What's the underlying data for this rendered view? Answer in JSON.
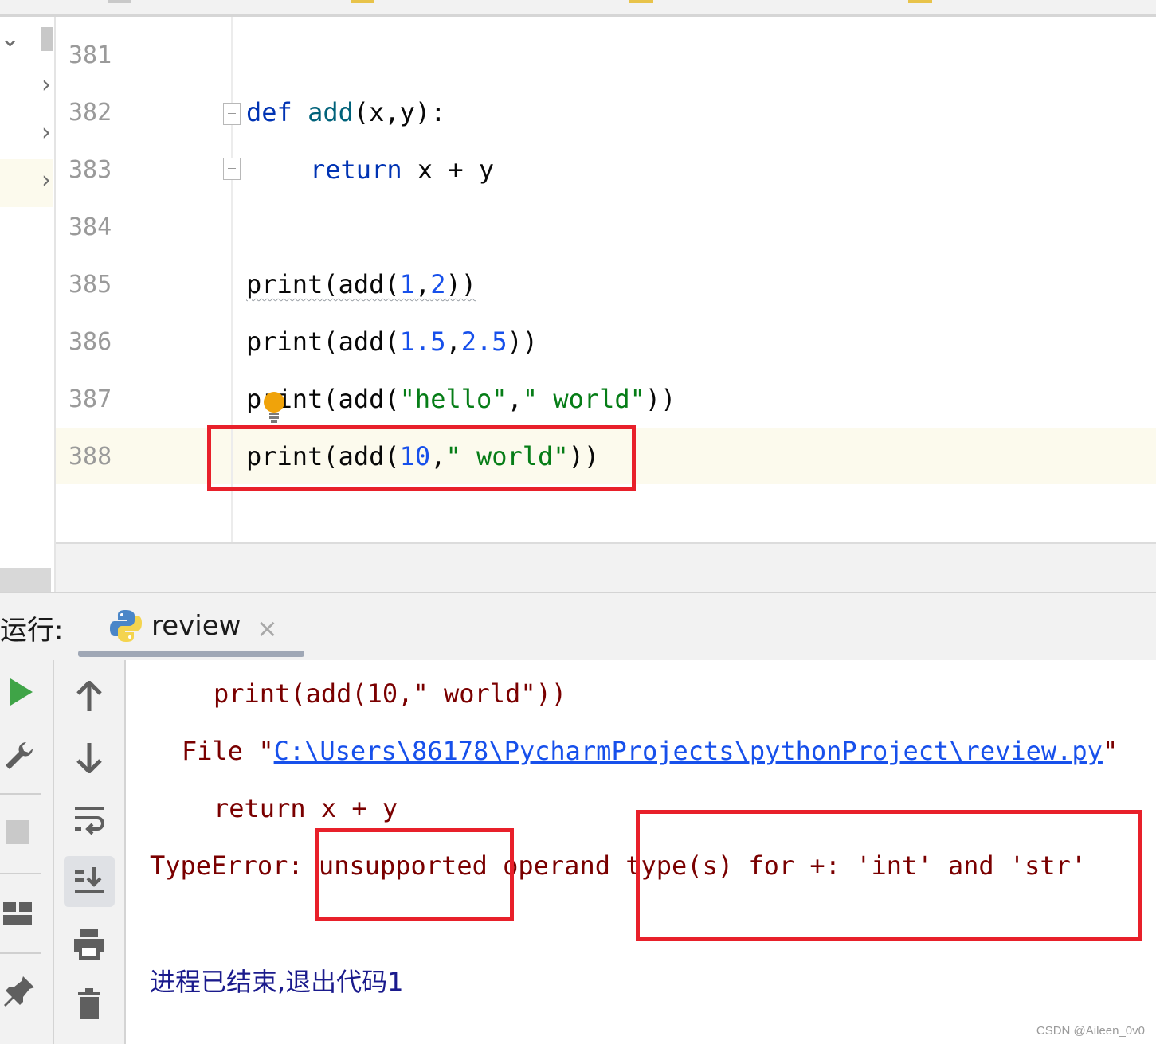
{
  "editor": {
    "lines": [
      {
        "num": "381"
      },
      {
        "num": "382"
      },
      {
        "num": "383"
      },
      {
        "num": "384"
      },
      {
        "num": "385"
      },
      {
        "num": "386"
      },
      {
        "num": "387"
      },
      {
        "num": "388"
      }
    ],
    "code": {
      "l382_def": "def",
      "l382_name": "add",
      "l382_params": "(x,y):",
      "l383_return": "return",
      "l383_expr": " x + y",
      "l385_print": "print",
      "l385_open": "(add(",
      "l385_a": "1",
      "l385_comma": ",",
      "l385_b": "2",
      "l385_close": "))",
      "l386_print": "print",
      "l386_open": "(add(",
      "l386_a": "1.5",
      "l386_comma": ",",
      "l386_b": "2.5",
      "l386_close": "))",
      "l387_print": "print",
      "l387_open": "(add(",
      "l387_a": "\"hello\"",
      "l387_comma": ",",
      "l387_b": "\" world\"",
      "l387_close": "))",
      "l388_print": "print",
      "l388_open": "(add(",
      "l388_a": "10",
      "l388_comma": ",",
      "l388_b": "\" world\"",
      "l388_close": "))"
    }
  },
  "run": {
    "label": "运行:",
    "tab_title": "review",
    "tab_close": "×"
  },
  "console": {
    "line1": "print(add(10,\" world\"))",
    "line2_prefix": "File \"",
    "line2_path": "C:\\Users\\86178\\PycharmProjects\\pythonProject\\review.py",
    "line2_suffix": "\"",
    "line3": "return x + y",
    "err_type": "TypeError: ",
    "err_word1": "unsupported",
    "err_word2": " operand ",
    "err_rest": "type(s) for +: 'int' and 'str'",
    "exit_message": "进程已结束,退出代码1"
  },
  "watermark": "CSDN @Aileen_0v0",
  "colors": {
    "keyword": "#0033b3",
    "function": "#00627a",
    "number": "#1750eb",
    "string": "#067d17",
    "error_text": "#7a0000",
    "highlight_box": "#e8202a",
    "current_line": "#fcfaed"
  }
}
